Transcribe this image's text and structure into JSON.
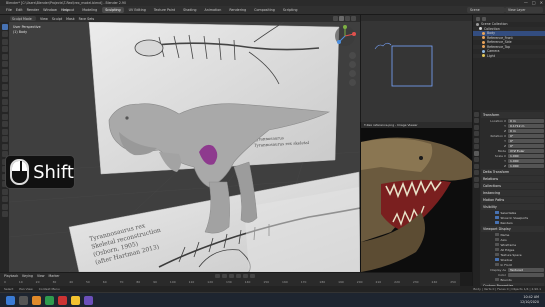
{
  "app": {
    "title": "Blender* [C:\\Users\\Blender\\Projects\\T-Rex\\trex_model.blend] - Blender 2.90",
    "window_controls": [
      "—",
      "□",
      "✕"
    ]
  },
  "menus": [
    "File",
    "Edit",
    "Render",
    "Window",
    "Help"
  ],
  "workspace_tabs": [
    {
      "label": "Layout",
      "active": false
    },
    {
      "label": "Modeling",
      "active": false
    },
    {
      "label": "Sculpting",
      "active": true
    },
    {
      "label": "UV Editing",
      "active": false
    },
    {
      "label": "Texture Paint",
      "active": false
    },
    {
      "label": "Shading",
      "active": false
    },
    {
      "label": "Animation",
      "active": false
    },
    {
      "label": "Rendering",
      "active": false
    },
    {
      "label": "Compositing",
      "active": false
    },
    {
      "label": "Scripting",
      "active": false
    }
  ],
  "scene": {
    "name": "Scene",
    "view_layer": "View Layer"
  },
  "viewport": {
    "mode": "Sculpt Mode",
    "menus": [
      "View",
      "Sculpt",
      "Mask",
      "Face Sets"
    ],
    "overlay_lines": [
      "User Perspective",
      "(1) Body"
    ],
    "shift_label": "Shift"
  },
  "reference_sheet": {
    "title": "Tyrannosaurus",
    "subtitle": "Tyrannosaurus rex skeletal",
    "caption_lines": [
      "Tyrannosaurus rex",
      "Skeletal reconstruction",
      "(Osborn, 1905)",
      "(after Hartman 2013)"
    ]
  },
  "image_viewer": {
    "title": "T-Rex reference.png - Image Viewer"
  },
  "outliner": {
    "rows": [
      {
        "label": "Scene Collection",
        "color": "#9a9a9a",
        "selected": false
      },
      {
        "label": "Collection",
        "color": "#d8d8d8",
        "selected": false
      },
      {
        "label": "Body",
        "color": "#e8a35a",
        "selected": true
      },
      {
        "label": "Reference_Front",
        "color": "#e8a35a",
        "selected": false
      },
      {
        "label": "Reference_Side",
        "color": "#e8a35a",
        "selected": false
      },
      {
        "label": "Reference_Top",
        "color": "#e8a35a",
        "selected": false
      },
      {
        "label": "Camera",
        "color": "#8fb7e0",
        "selected": false
      },
      {
        "label": "Light",
        "color": "#e0c65a",
        "selected": false
      }
    ]
  },
  "properties": {
    "sections": [
      {
        "title": "Transform",
        "rows": [
          {
            "label": "Location X",
            "value": "0 m"
          },
          {
            "label": "Y",
            "value": "0.1712 m"
          },
          {
            "label": "Z",
            "value": "0 m"
          },
          {
            "label": "Rotation X",
            "value": "0°"
          },
          {
            "label": "Y",
            "value": "0°"
          },
          {
            "label": "Z",
            "value": "0°"
          },
          {
            "label": "Mode",
            "value": "XYZ Euler"
          },
          {
            "label": "Scale X",
            "value": "1.000"
          },
          {
            "label": "Y",
            "value": "1.000"
          },
          {
            "label": "Z",
            "value": "1.000"
          }
        ]
      },
      {
        "title": "Delta Transform",
        "rows": []
      },
      {
        "title": "Relations",
        "rows": []
      },
      {
        "title": "Collections",
        "rows": []
      },
      {
        "title": "Instancing",
        "rows": []
      },
      {
        "title": "Motion Paths",
        "rows": []
      },
      {
        "title": "Visibility",
        "rows": [
          {
            "label": "Selectable",
            "check": true
          },
          {
            "label": "Show In Viewports",
            "check": true
          },
          {
            "label": "Renders",
            "check": true
          }
        ]
      },
      {
        "title": "Viewport Display",
        "rows": [
          {
            "label": "Name",
            "check": false
          },
          {
            "label": "Axis",
            "check": false
          },
          {
            "label": "Wireframe",
            "check": false
          },
          {
            "label": "All Edges",
            "check": false
          },
          {
            "label": "Texture Space",
            "check": false
          },
          {
            "label": "Shadow",
            "check": true
          },
          {
            "label": "In Front",
            "check": false
          },
          {
            "label": "Display As",
            "value": "Textured"
          },
          {
            "label": "Color",
            "value": ""
          },
          {
            "label": "Bounds",
            "check": false
          }
        ]
      },
      {
        "title": "Custom Properties",
        "rows": []
      }
    ]
  },
  "timeline": {
    "menus": [
      "Playback",
      "Keying",
      "View",
      "Marker"
    ],
    "frames": [
      "0",
      "10",
      "20",
      "30",
      "40",
      "50",
      "60",
      "70",
      "80",
      "90",
      "100",
      "110",
      "120",
      "130",
      "140",
      "150",
      "160",
      "170",
      "180",
      "190",
      "200",
      "210",
      "220",
      "230",
      "240",
      "250"
    ]
  },
  "status": {
    "left": [
      "Select",
      "Pan View",
      "Context Menu"
    ],
    "right": "Body | Verts 0 | Faces 0 | Objects 1/4 | 2.90.1"
  },
  "taskbar": {
    "time": "10:42 AM",
    "date": "12/10/2020"
  }
}
